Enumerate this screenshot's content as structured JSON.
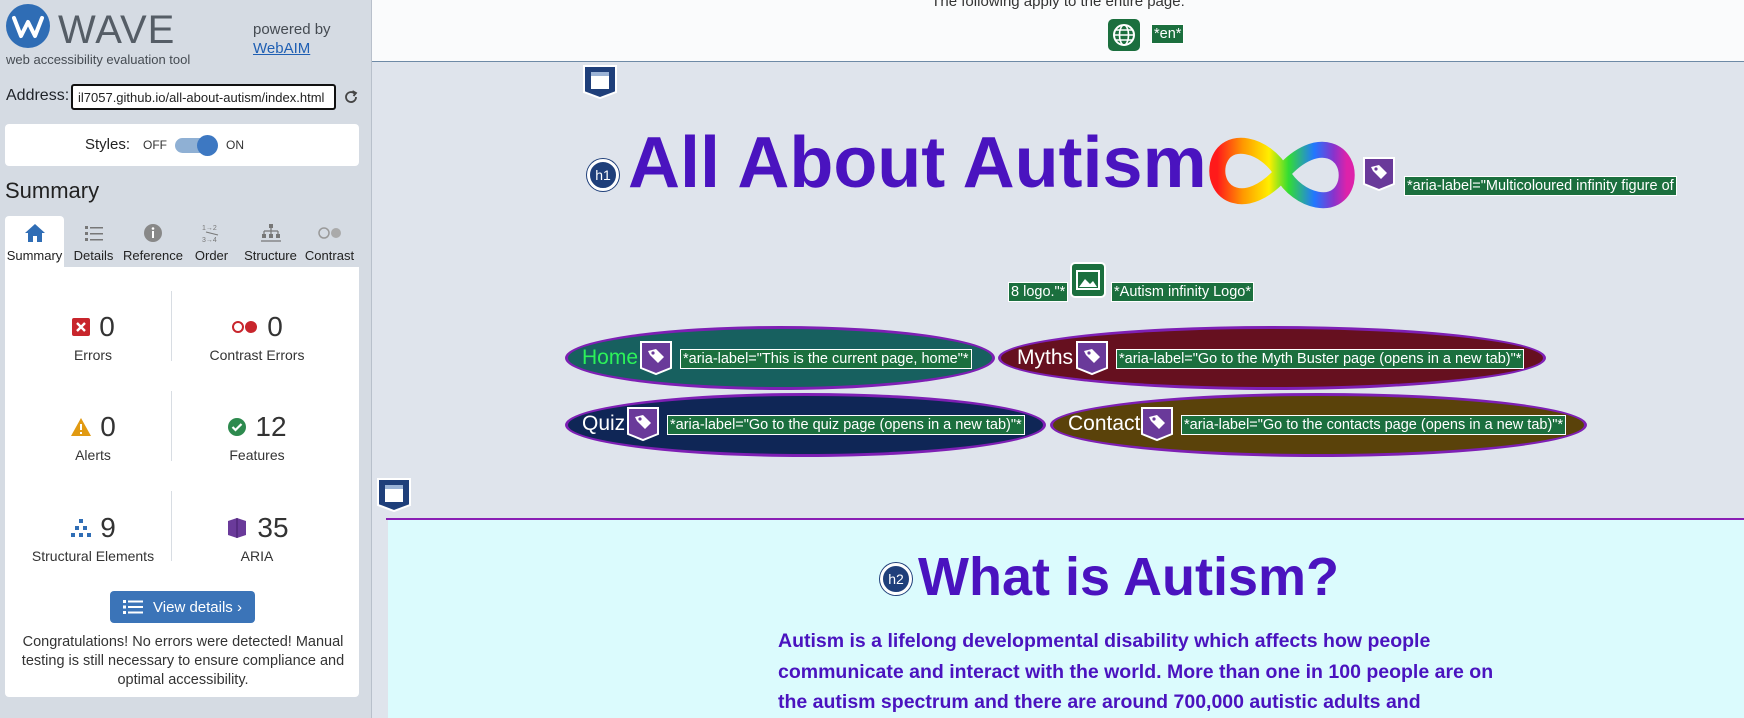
{
  "wave": {
    "logo_word": "WAVE",
    "tagline": "web accessibility evaluation tool",
    "powered_by": "powered by",
    "webaim_link": "WebAIM",
    "address_label": "Address:",
    "address_value": "il7057.github.io/all-about-autism/index.html",
    "styles_label": "Styles:",
    "styles_off": "OFF",
    "styles_on": "ON",
    "styles_state": "on",
    "summary_title": "Summary",
    "tabs": [
      {
        "label": "Summary",
        "icon": "home-icon",
        "active": true
      },
      {
        "label": "Details",
        "icon": "list-icon",
        "active": false
      },
      {
        "label": "Reference",
        "icon": "info-icon",
        "active": false
      },
      {
        "label": "Order",
        "icon": "order-icon",
        "active": false
      },
      {
        "label": "Structure",
        "icon": "structure-icon",
        "active": false
      },
      {
        "label": "Contrast",
        "icon": "contrast-icon",
        "active": false
      }
    ],
    "stats": {
      "errors": {
        "count": "0",
        "label": "Errors",
        "icon": "error-icon",
        "color": "#c8252c"
      },
      "contrast_errors": {
        "count": "0",
        "label": "Contrast Errors",
        "icon": "contrast-error-icon",
        "color": "#c8252c"
      },
      "alerts": {
        "count": "0",
        "label": "Alerts",
        "icon": "alert-icon",
        "color": "#e19a12"
      },
      "features": {
        "count": "12",
        "label": "Features",
        "icon": "feature-check-icon",
        "color": "#2d8a4e"
      },
      "structural": {
        "count": "9",
        "label": "Structural Elements",
        "icon": "structure-tree-icon",
        "color": "#2f6db5"
      },
      "aria": {
        "count": "35",
        "label": "ARIA",
        "icon": "aria-cube-icon",
        "color": "#6a3a9a"
      }
    },
    "view_details": "View details ›",
    "congrats": "Congratulations! No errors were detected! Manual testing is still necessary to ensure compliance and optimal accessibility."
  },
  "page": {
    "doc_note": "The following apply to the entire page:",
    "lang_tag": "*en*",
    "h1_badge": "h1",
    "h1_text": "All About Autism",
    "infinity_aria_a": "*aria-label=\"Multicoloured infinity figure of",
    "infinity_aria_b": "8 logo.\"*",
    "infinity_alt": "*Autism infinity Logo*",
    "nav": [
      {
        "label": "Home",
        "aria": "*aria-label=\"This is the current page, home\"*",
        "bg": "#17605f",
        "text_color": "#2cf25a"
      },
      {
        "label": "Myths",
        "aria": "*aria-label=\"Go to the Myth Buster page (opens in a new tab)\"*",
        "bg": "#66101f",
        "text_color": "#ffffff"
      },
      {
        "label": "Quiz",
        "aria": "*aria-label=\"Go to the quiz page (opens in a new tab)\"*",
        "bg": "#0f2656",
        "text_color": "#ffffff"
      },
      {
        "label": "Contact",
        "aria": "*aria-label=\"Go to the contacts page (opens in a new tab)\"*",
        "bg": "#5a420a",
        "text_color": "#ffffff"
      }
    ],
    "h2_badge": "h2",
    "h2_text": "What is Autism?",
    "paragraph": "Autism is a lifelong developmental disability which affects how people communicate and interact with the world. More than one in 100 people are on the autism spectrum and there are around 700,000 autistic adults and"
  }
}
